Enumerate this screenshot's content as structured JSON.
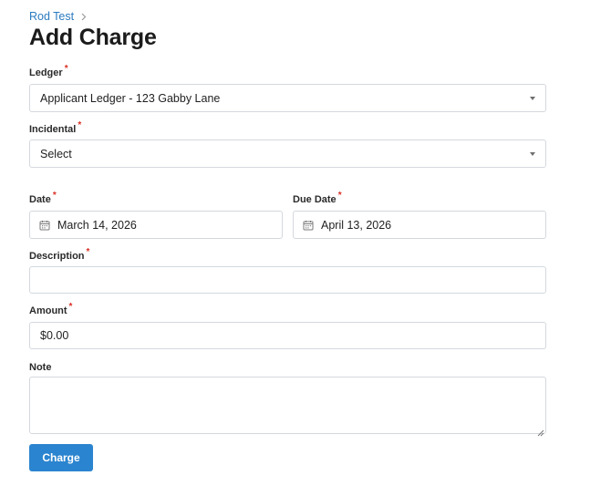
{
  "breadcrumb": {
    "parent": "Rod Test",
    "separator_icon": "chevron-right-icon"
  },
  "page": {
    "title": "Add Charge"
  },
  "form": {
    "required_marker": "*",
    "ledger": {
      "label": "Ledger",
      "value": "Applicant Ledger - 123 Gabby Lane"
    },
    "incidental": {
      "label": "Incidental",
      "value": "Select"
    },
    "date": {
      "label": "Date",
      "value": "March 14, 2026",
      "icon": "calendar-icon"
    },
    "due_date": {
      "label": "Due Date",
      "value": "April 13, 2026",
      "icon": "calendar-icon"
    },
    "description": {
      "label": "Description",
      "value": ""
    },
    "amount": {
      "label": "Amount",
      "value": "$0.00"
    },
    "note": {
      "label": "Note",
      "value": ""
    },
    "submit_label": "Charge"
  },
  "colors": {
    "accent": "#2b84cf",
    "link": "#2b7bbf",
    "required": "#d93025",
    "border": "#d4d8dd"
  }
}
